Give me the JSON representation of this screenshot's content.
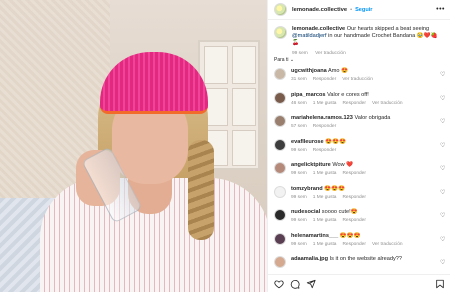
{
  "post": {
    "username": "lemonade.collective",
    "separator": "•",
    "follow_label": "Seguir",
    "more_label": "•••",
    "caption_user": "lemonade.collective",
    "caption_text_1": "Our hearts skipped a beat seeing ",
    "caption_mention": "@matildadjerf",
    "caption_text_2": " in our handmade Crochet Bandana 🥹❤️🍓🍒",
    "caption_time": "99 sem",
    "caption_translate": "Ver traducción",
    "filter_label": "Para ti ⌄"
  },
  "comments": [
    {
      "user": "ugcwithjoana",
      "text": "Amo 😍",
      "time": "31 sem",
      "likes": "",
      "reply": "Responder",
      "extra": "Ver traducción",
      "avatar_color": "#c9b8a6"
    },
    {
      "user": "pipa_marcos",
      "text": "Valor e cores off!",
      "time": "46 sem",
      "likes": "1 Me gusta",
      "reply": "Responder",
      "extra": "Ver traducción",
      "avatar_color": "#7a5c4c"
    },
    {
      "user": "mariahelena.ramos.123",
      "text": "Valor obrigada",
      "time": "57 sem",
      "likes": "",
      "reply": "Responder",
      "extra": "",
      "avatar_color": "#9a7f6e"
    },
    {
      "user": "evaflleurose",
      "text": "😍😍😍",
      "time": "99 sem",
      "likes": "",
      "reply": "Responder",
      "extra": "",
      "avatar_color": "#3d3d3d"
    },
    {
      "user": "angelicktpiture",
      "text": "Wow ❤️",
      "time": "99 sem",
      "likes": "1 Me gusta",
      "reply": "Responder",
      "extra": "",
      "avatar_color": "#b58a7b"
    },
    {
      "user": "tomzybrand",
      "text": "😍😍😍",
      "time": "99 sem",
      "likes": "1 Me gusta",
      "reply": "Responder",
      "extra": "",
      "avatar_color": "#f2f2f2"
    },
    {
      "user": "nudesocial",
      "text": "soooo cute!😍",
      "time": "99 sem",
      "likes": "1 Me gusta",
      "reply": "Responder",
      "extra": "",
      "avatar_color": "#2a2a2a"
    },
    {
      "user": "helenamartins___",
      "text": "😍😍😍",
      "time": "99 sem",
      "likes": "1 Me gusta",
      "reply": "Responder",
      "extra": "Ver traducción",
      "avatar_color": "#5a3f52"
    },
    {
      "user": "adaamalia.jpg",
      "text": "Is it on the website already??",
      "time": "",
      "likes": "",
      "reply": "",
      "extra": "",
      "avatar_color": "#d4a98f"
    }
  ],
  "actions": {
    "like_icon": "heart-icon",
    "comment_icon": "comment-icon",
    "share_icon": "share-icon",
    "save_icon": "bookmark-icon"
  },
  "colors": {
    "link_blue": "#0095f6",
    "mention_blue": "#00376b",
    "muted_gray": "#8e8e8e",
    "bandana_pink": "#e2297f",
    "bandana_orange": "#f26b2b"
  }
}
